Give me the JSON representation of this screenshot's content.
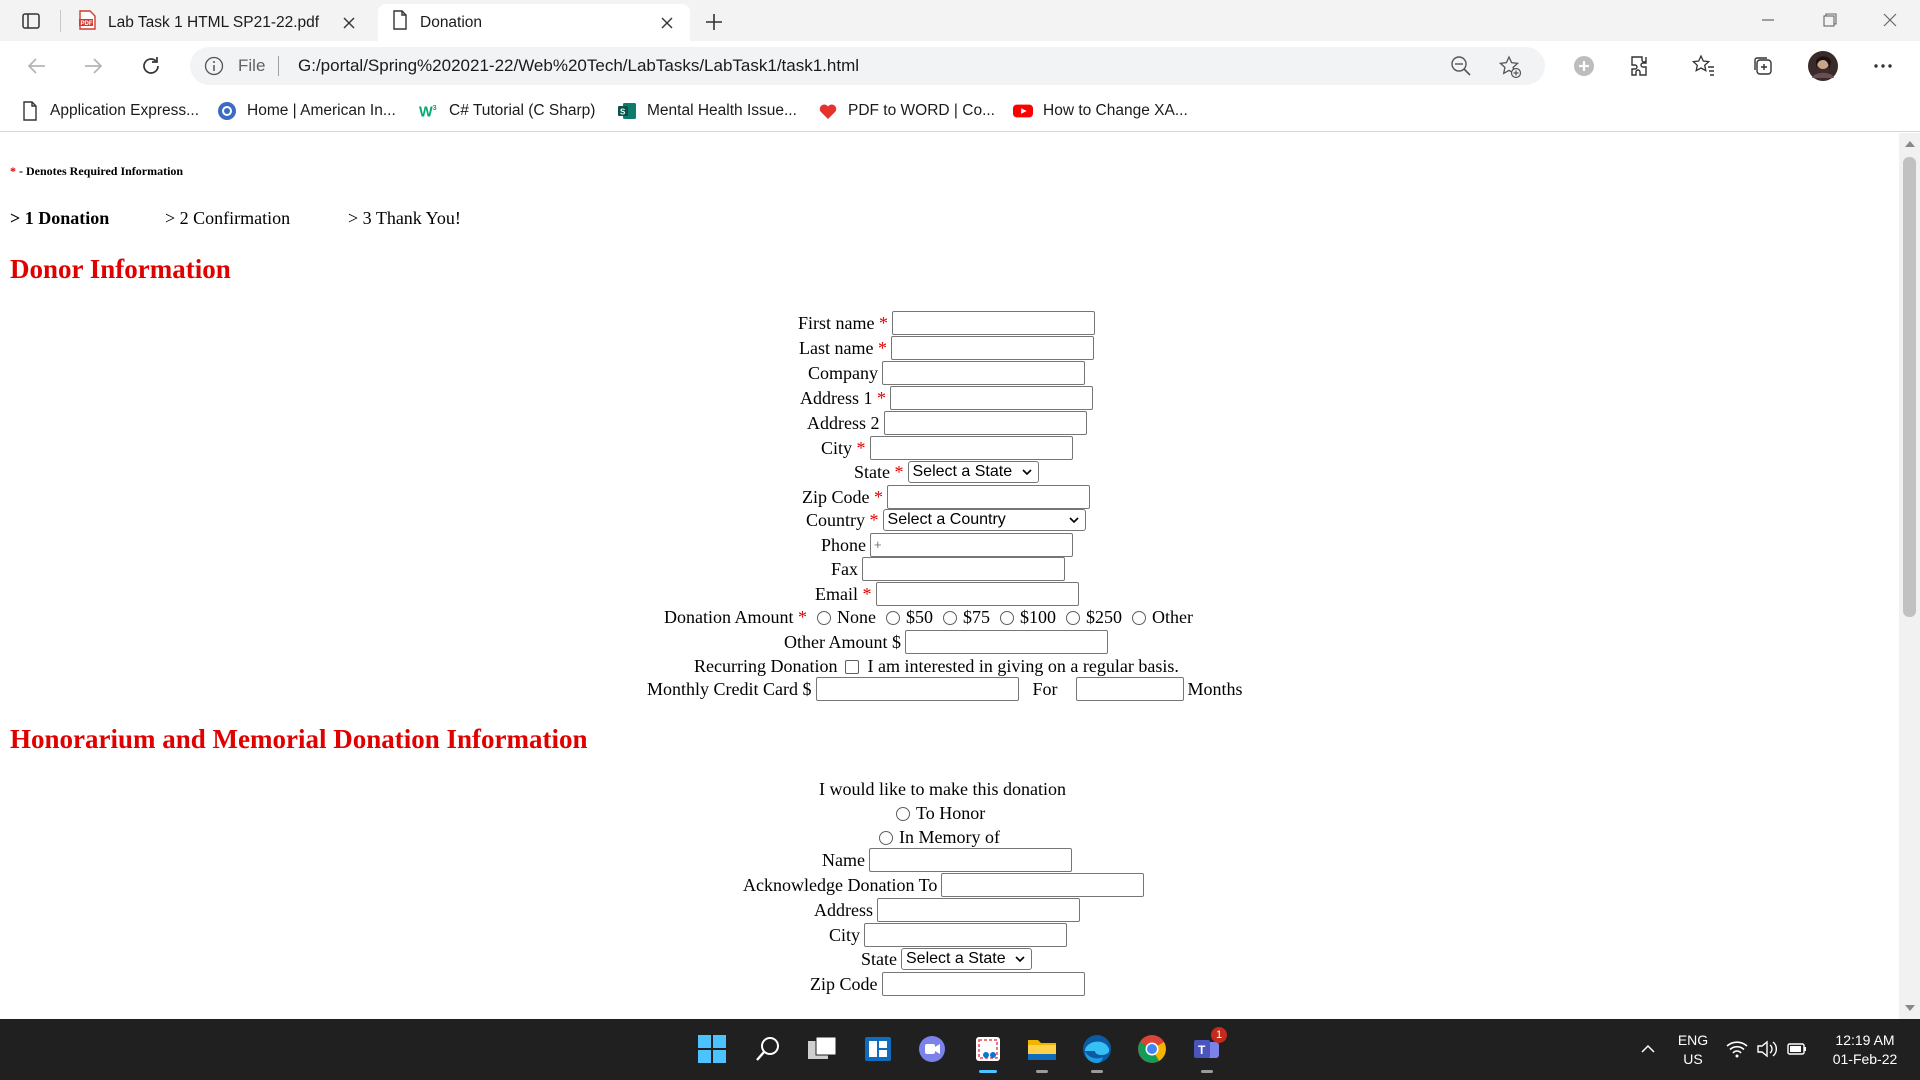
{
  "browser": {
    "tabs": [
      {
        "title": "Lab Task 1 HTML SP21-22.pdf",
        "icon": "pdf-icon"
      },
      {
        "title": "Donation",
        "icon": "page-icon"
      }
    ],
    "address": {
      "scheme_label": "File",
      "url": "G:/portal/Spring%202021-22/Web%20Tech/LabTasks/LabTask1/task1.html"
    },
    "bookmarks": [
      {
        "label": "Application Express...",
        "icon": "page-icon"
      },
      {
        "label": "Home | American In...",
        "icon": "globe-icon"
      },
      {
        "label": "C# Tutorial (C Sharp)",
        "icon": "w3-icon"
      },
      {
        "label": "Mental Health Issue...",
        "icon": "sway-icon"
      },
      {
        "label": "PDF to WORD | Co...",
        "icon": "heart-icon"
      },
      {
        "label": "How to Change XA...",
        "icon": "youtube-icon"
      }
    ]
  },
  "page": {
    "required_marker": "*",
    "required_note": " - Denotes Required Information",
    "steps": [
      "> 1 Donation",
      "> 2 Confirmation",
      "> 3 Thank You!"
    ],
    "donor_section": {
      "title": "Donor Information",
      "fields": {
        "first_name": "First name",
        "last_name": "Last name",
        "company": "Company",
        "address1": "Address 1",
        "address2": "Address 2",
        "city": "City",
        "state": "State",
        "state_select": "Select a State",
        "zip": "Zip Code",
        "country": "Country",
        "country_select": "Select a Country",
        "phone": "Phone",
        "phone_value": "+",
        "fax": "Fax",
        "email": "Email",
        "donation_amount": "Donation Amount",
        "donation_options": [
          "None",
          "$50",
          "$75",
          "$100",
          "$250",
          "Other"
        ],
        "other_amount": "Other Amount $",
        "recurring": "Recurring Donation",
        "recurring_text": "I am interested in giving on a regular basis.",
        "monthly": "Monthly Credit Card $",
        "for": "For",
        "months": "Months"
      }
    },
    "honor_section": {
      "title": "Honorarium and Memorial Donation Information",
      "intro": "I would like to make this donation",
      "options": [
        "To Honor",
        "In Memory of"
      ],
      "fields": {
        "name": "Name",
        "acknowledge": "Acknowledge Donation To",
        "address": "Address",
        "city": "City",
        "state": "State",
        "state_select": "Select a State",
        "zip": "Zip Code"
      }
    }
  },
  "taskbar": {
    "apps": [
      "start-icon",
      "search-icon",
      "task-view-icon",
      "widgets-icon",
      "teams-chat-icon",
      "snipping-tool-icon",
      "file-explorer-icon",
      "edge-icon",
      "chrome-icon",
      "teams-icon"
    ],
    "teams_badge": "1",
    "language": [
      "ENG",
      "US"
    ],
    "time": "12:19 AM",
    "date": "01-Feb-22"
  },
  "colors": {
    "required": "#e00000",
    "section_title": "#e00000",
    "taskbar": "#202020",
    "accent": "#4cc2ff"
  }
}
